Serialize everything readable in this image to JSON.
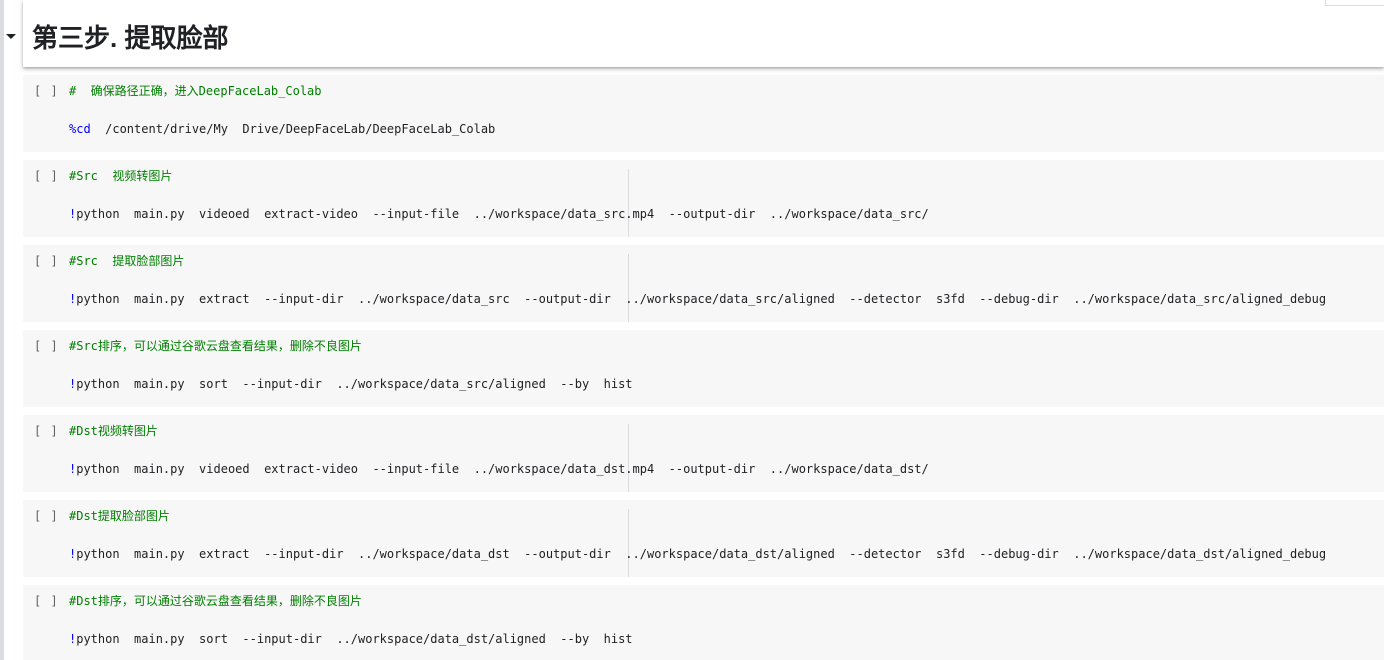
{
  "section": {
    "title": "第三步. 提取脸部"
  },
  "run_indicator": "[ ]",
  "cells": [
    {
      "comment": "#  确保路径正确，进入DeepFaceLab_Colab",
      "prefix": "%cd",
      "command": "  /content/drive/My  Drive/DeepFaceLab/DeepFaceLab_Colab"
    },
    {
      "comment": "#Src  视频转图片",
      "prefix": "!",
      "command": "python  main.py  videoed  extract-video  --input-file  ../workspace/data_src.mp4  --output-dir  ../workspace/data_src/"
    },
    {
      "comment": "#Src  提取脸部图片",
      "prefix": "!",
      "command": "python  main.py  extract  --input-dir  ../workspace/data_src  --output-dir  ../workspace/data_src/aligned  --detector  s3fd  --debug-dir  ../workspace/data_src/aligned_debug"
    },
    {
      "comment": "#Src排序，可以通过谷歌云盘查看结果，删除不良图片",
      "prefix": "!",
      "command": "python  main.py  sort  --input-dir  ../workspace/data_src/aligned  --by  hist"
    },
    {
      "comment": "#Dst视频转图片",
      "prefix": "!",
      "command": "python  main.py  videoed  extract-video  --input-file  ../workspace/data_dst.mp4  --output-dir  ../workspace/data_dst/"
    },
    {
      "comment": "#Dst提取脸部图片",
      "prefix": "!",
      "command": "python  main.py  extract  --input-dir  ../workspace/data_dst  --output-dir  ../workspace/data_dst/aligned  --detector  s3fd  --debug-dir  ../workspace/data_dst/aligned_debug"
    },
    {
      "comment": "#Dst排序，可以通过谷歌云盘查看结果，删除不良图片",
      "prefix": "!",
      "command": "python  main.py  sort  --input-dir  ../workspace/data_dst/aligned  --by  hist"
    }
  ],
  "icons": {
    "collapse": "caret-down-icon"
  },
  "colors": {
    "comment": "#008000",
    "magic_prefix": "#0000ff",
    "code": "#202124",
    "cell_background": "#f7f7f7"
  }
}
